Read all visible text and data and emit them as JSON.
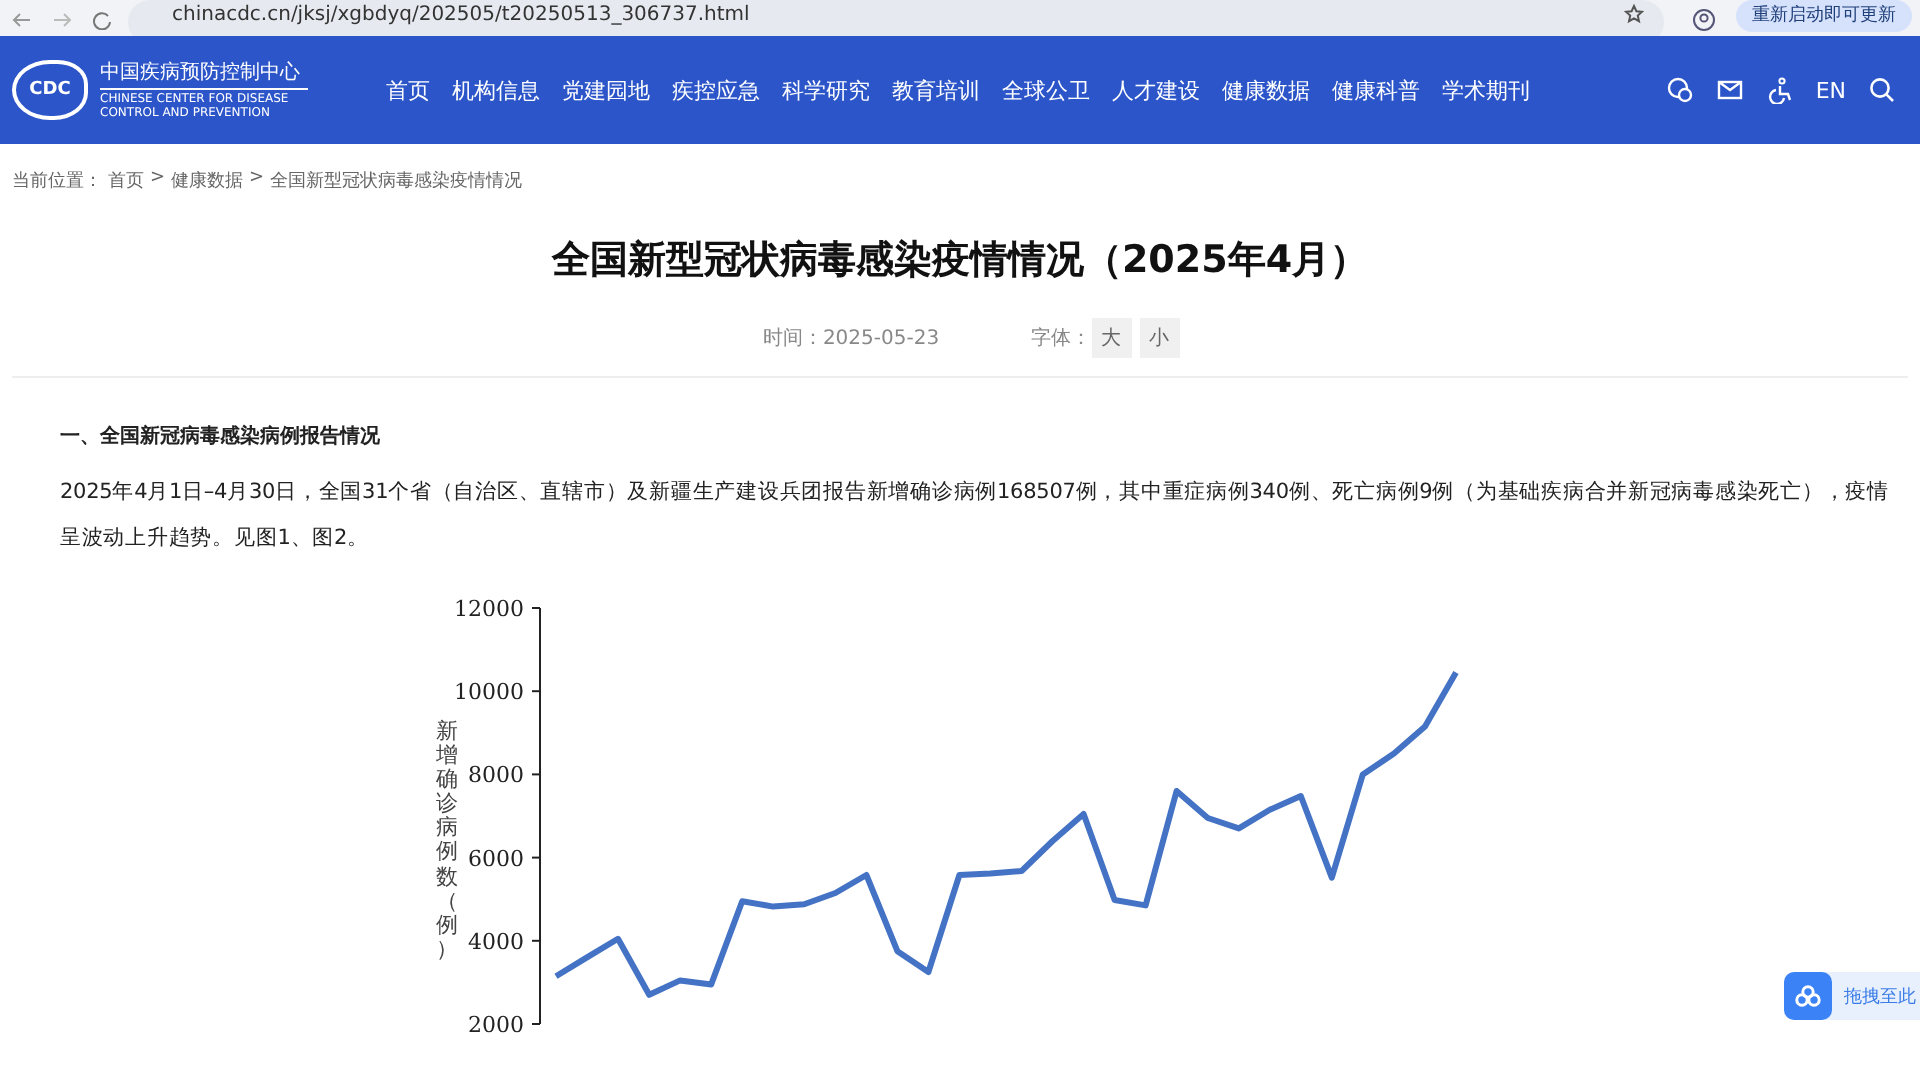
{
  "browser": {
    "url": "chinacdc.cn/jksj/xgbdyq/202505/t20250513_306737.html",
    "update_button": "重新启动即可更新"
  },
  "header": {
    "logo_mark": "CDC",
    "logo_name": "中国疾病预防控制中心",
    "logo_subtitle": "CHINESE CENTER FOR DISEASE CONTROL AND PREVENTION",
    "nav": [
      "首页",
      "机构信息",
      "党建园地",
      "疾控应急",
      "科学研究",
      "教育培训",
      "全球公卫",
      "人才建设",
      "健康数据",
      "健康科普",
      "学术期刊"
    ],
    "language": "EN"
  },
  "breadcrumb": {
    "label": "当前位置：",
    "separator": ">",
    "items": [
      "首页",
      "健康数据",
      "全国新型冠状病毒感染疫情情况"
    ]
  },
  "article": {
    "title": "全国新型冠状病毒感染疫情情况（2025年4月）",
    "time_label": "时间：",
    "time": "2025-05-23",
    "font_label": "字体：",
    "font_sizes": [
      "大",
      "小"
    ],
    "section_heading": "一、全国新冠病毒感染病例报告情况",
    "paragraph": "2025年4月1日–4月30日，全国31个省（自治区、直辖市）及新疆生产建设兵团报告新增确诊病例168507例，其中重症病例340例、死亡病例9例（为基础疾病合并新冠病毒感染死亡），疫情呈波动上升趋势。见图1、图2。",
    "chart_data": {
      "type": "line",
      "ylabel": "新增确诊病例数（例）",
      "ylim": [
        2000,
        12000
      ],
      "yticks": [
        2000,
        4000,
        6000,
        8000,
        10000,
        12000
      ],
      "series": [
        {
          "color": "#4472c4",
          "values": [
            3150,
            3600,
            4050,
            2700,
            3050,
            2950,
            4950,
            4820,
            4880,
            5150,
            5580,
            3750,
            3250,
            5580,
            5620,
            5680,
            6400,
            7050,
            4980,
            4850,
            7600,
            6950,
            6700,
            7150,
            7480,
            5520,
            8000,
            8500,
            9150,
            10450
          ]
        }
      ]
    }
  },
  "float_widget": {
    "label": "拖拽至此"
  }
}
